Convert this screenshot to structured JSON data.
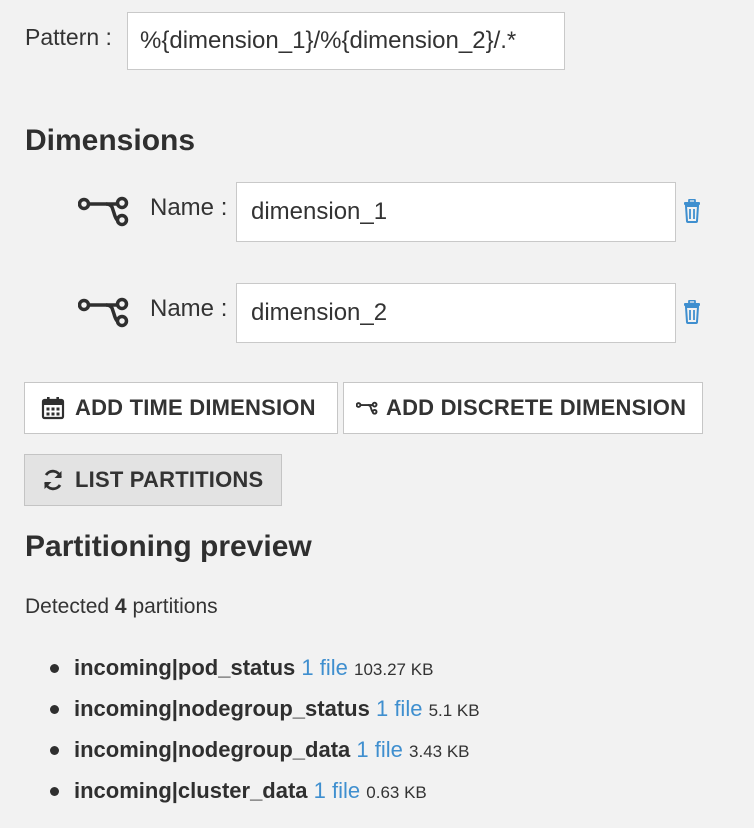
{
  "pattern": {
    "label": "Pattern :",
    "value": "%{dimension_1}/%{dimension_2}/.*"
  },
  "dimensions": {
    "title": "Dimensions",
    "name_label": "Name :",
    "items": [
      {
        "value": "dimension_1",
        "icon": "discrete-dimension-icon"
      },
      {
        "value": "dimension_2",
        "icon": "discrete-dimension-icon"
      }
    ],
    "delete_icon": "trash-icon",
    "accent_color": "#3f8fcf"
  },
  "buttons": {
    "add_time": "ADD TIME DIMENSION",
    "add_discrete": "ADD DISCRETE DIMENSION",
    "list_partitions": "LIST PARTITIONS"
  },
  "preview": {
    "title": "Partitioning preview",
    "detected_prefix": "Detected",
    "detected_count": "4",
    "detected_suffix": "partitions",
    "partitions": [
      {
        "name": "incoming|pod_status",
        "files": "1 file",
        "size": "103.27 KB"
      },
      {
        "name": "incoming|nodegroup_status",
        "files": "1 file",
        "size": "5.1 KB"
      },
      {
        "name": "incoming|nodegroup_data",
        "files": "1 file",
        "size": "3.43 KB"
      },
      {
        "name": "incoming|cluster_data",
        "files": "1 file",
        "size": "0.63 KB"
      }
    ]
  }
}
